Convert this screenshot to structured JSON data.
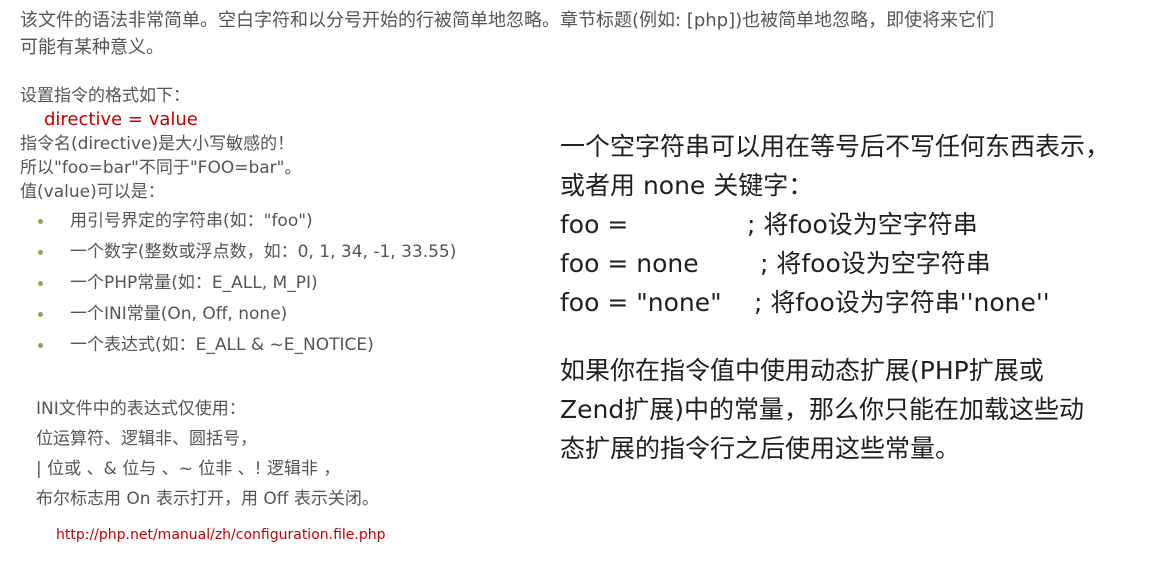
{
  "intro": {
    "line1": "该文件的语法非常简单。空白字符和以分号开始的行被简单地忽略。章节标题(例如: [php])也被简单地忽略，即使将来它们",
    "line2": "可能有某种意义。"
  },
  "left": {
    "format_heading": "设置指令的格式如下：",
    "directive": "directive = value",
    "case_note": "指令名(directive)是大小写敏感的！",
    "case_example": "所以\"foo=bar\"不同于\"FOO=bar\"。",
    "value_heading": "值(value)可以是：",
    "value_types": [
      "用引号界定的字符串(如：\"foo\")",
      "一个数字(整数或浮点数，如：0, 1, 34, -1, 33.55)",
      "一个PHP常量(如：E_ALL, M_PI)",
      "一个INI常量(On, Off, none)",
      "一个表达式(如：E_ALL & ~E_NOTICE)"
    ],
    "ini_lines": [
      "INI文件中的表达式仅使用：",
      "位运算符、逻辑非、圆括号，",
      "| 位或 、& 位与 、~ 位非 、! 逻辑非 ，",
      "布尔标志用 On 表示打开，用 Off 表示关闭。"
    ],
    "url": "http://php.net/manual/zh/configuration.file.php"
  },
  "right": {
    "empty_string_line1": "一个空字符串可以用在等号后不写任何东西表示，",
    "empty_string_line2": "或者用 none 关键字：",
    "examples": [
      {
        "code": "foo =",
        "comment": "; 将foo设为空字符串"
      },
      {
        "code": "foo = none",
        "comment": "; 将foo设为空字符串"
      },
      {
        "code": "foo = \"none\"",
        "comment": "; 将foo设为字符串''none''"
      }
    ],
    "dynamic_ext_lines": [
      "如果你在指令值中使用动态扩展(PHP扩展或",
      "Zend扩展)中的常量，那么你只能在加载这些动",
      "态扩展的指令行之后使用这些常量。"
    ]
  },
  "colors": {
    "text": "#555555",
    "accent_red": "#c00000",
    "bullet_green": "#8aa84e",
    "dark_text": "#1f1f1f"
  }
}
